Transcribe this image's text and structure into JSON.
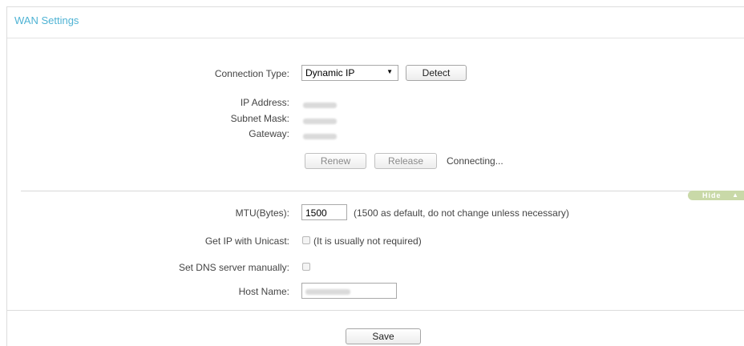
{
  "header": {
    "title": "WAN Settings"
  },
  "connection": {
    "type_label": "Connection Type:",
    "type_value": "Dynamic IP",
    "detect_label": "Detect",
    "ip_label": "IP Address:",
    "mask_label": "Subnet Mask:",
    "gateway_label": "Gateway:",
    "renew_label": "Renew",
    "release_label": "Release",
    "status": "Connecting..."
  },
  "advanced": {
    "hide_label": "Hide",
    "mtu_label": "MTU(Bytes):",
    "mtu_value": "1500",
    "mtu_hint": "(1500 as default, do not change unless necessary)",
    "unicast_label": "Get IP with Unicast:",
    "unicast_hint": "(It is usually not required)",
    "unicast_checked": false,
    "dns_label": "Set DNS server manually:",
    "dns_checked": false,
    "host_label": "Host Name:"
  },
  "footer": {
    "save_label": "Save"
  },
  "colors": {
    "title": "#4fb3d4",
    "hide_badge": "#c9d9a8"
  }
}
